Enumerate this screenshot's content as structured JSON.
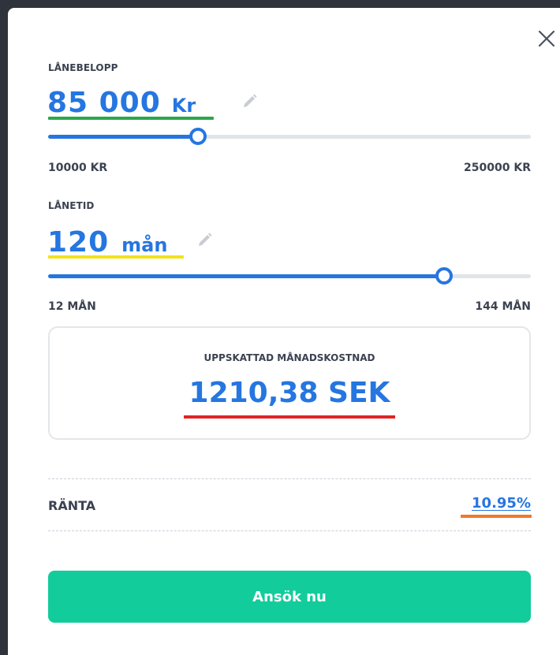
{
  "loan_amount": {
    "label": "LÅNEBELOPP",
    "value": "85 000",
    "unit": "Kr",
    "min_label": "10000 KR",
    "max_label": "250000 KR",
    "slider_fraction": 0.31,
    "underline_color": "#2aa84a"
  },
  "loan_term": {
    "label": "LÅNETID",
    "value": "120",
    "unit": "mån",
    "min_label": "12 MÅN",
    "max_label": "144 MÅN",
    "slider_fraction": 0.82,
    "underline_color": "#f2e21c"
  },
  "estimate": {
    "title": "UPPSKATTAD MÅNADSKOSTNAD",
    "value": "1210,38 SEK",
    "underline_color": "#e02424"
  },
  "rate": {
    "label": "RÄNTA",
    "value": "10.95%",
    "underline_color": "#f07a2a"
  },
  "apply_button": {
    "label": "Ansök nu"
  },
  "icons": {
    "close": "close-icon",
    "edit": "pencil-icon"
  },
  "colors": {
    "accent": "#2576e0",
    "button": "#13cc9c",
    "backdrop": "#2f343c"
  }
}
